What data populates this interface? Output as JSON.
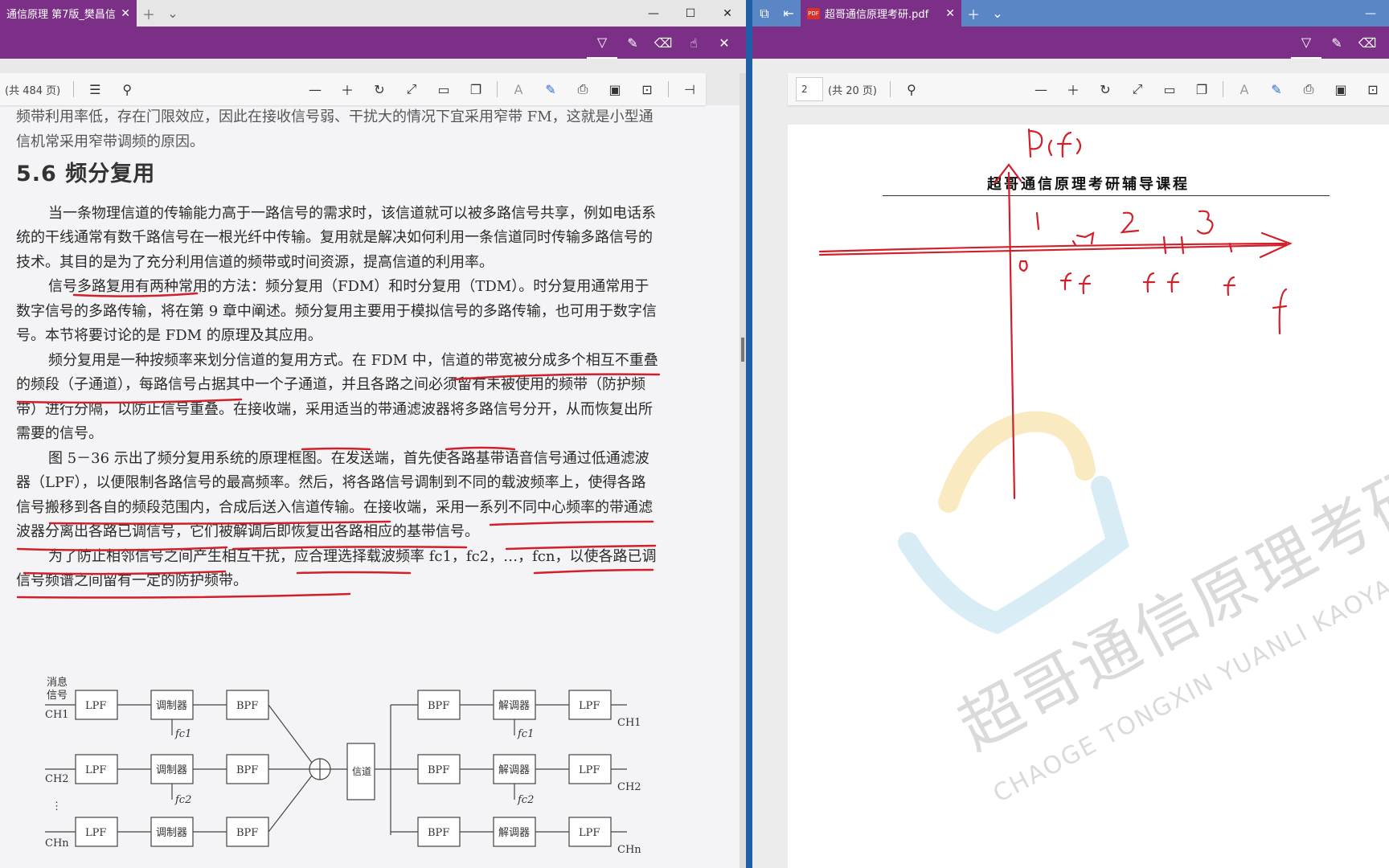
{
  "left_window": {
    "tab_title": "通信原理 第7版_樊昌信",
    "toolbar": {
      "page_total": "(共 484 页)"
    },
    "text": {
      "para0": "频带利用率低，存在门限效应，因此在接收信号弱、干扰大的情况下宜采用窄带 FM，这就是小型通信机常采用窄带调频的原因。",
      "section_heading": "5.6   频分复用",
      "para1": "当一条物理信道的传输能力高于一路信号的需求时，该信道就可以被多路信号共享，例如电话系统的干线通常有数千路信号在一根光纤中传输。复用就是解决如何利用一条信道同时传输多路信号的技术。其目的是为了充分利用信道的频带或时间资源，提高信道的利用率。",
      "para2": "信号多路复用有两种常用的方法：频分复用（FDM）和时分复用（TDM）。时分复用通常用于数字信号的多路传输，将在第 9 章中阐述。频分复用主要用于模拟信号的多路传输，也可用于数字信号。本节将要讨论的是 FDM 的原理及其应用。",
      "para3": "频分复用是一种按频率来划分信道的复用方式。在 FDM 中，信道的带宽被分成多个相互不重叠的频段（子通道），每路信号占据其中一个子通道，并且各路之间必须留有未被使用的频带（防护频带）进行分隔，以防止信号重叠。在接收端，采用适当的带通滤波器将多路信号分开，从而恢复出所需要的信号。",
      "para4": "图 5－36 示出了频分复用系统的原理框图。在发送端，首先使各路基带语音信号通过低通滤波器（LPF），以便限制各路信号的最高频率。然后，将各路信号调制到不同的载波频率上，使得各路信号搬移到各自的频段范围内，合成后送入信道传输。在接收端，采用一系列不同中心频率的带通滤波器分离出各路已调信号，它们被解调后即恢复出各路相应的基带信号。",
      "para5": "为了防止相邻信号之间产生相互干扰，应合理选择载波频率 fc1，fc2，…，fcn，以使各路已调信号频谱之间留有一定的防护频带。"
    },
    "diagram": {
      "source_label_1": "消息",
      "source_label_2": "信号",
      "ch1": "CH1",
      "ch2": "CH2",
      "chn": "CHn",
      "lpf": "LPF",
      "bpf": "BPF",
      "modulator": "调制器",
      "demodulator": "解调器",
      "channel": "信道",
      "fc1": "fc1",
      "fc2": "fc2",
      "dots": "⋮"
    }
  },
  "right_window": {
    "tab_title": "超哥通信原理考研.pdf",
    "toolbar": {
      "page_current": "2",
      "page_total": "(共 20 页)"
    },
    "doc_title": "超哥通信原理考研辅导课程",
    "watermark": "超哥通信原理考研",
    "watermark_sub": "CHAOGE TONGXIN YUANLI KAOYAN"
  },
  "colors": {
    "accent": "#7b2f86",
    "right_tabbar": "#5a86c6",
    "ink": "#d0202a",
    "divider": "#1f5fa8"
  }
}
